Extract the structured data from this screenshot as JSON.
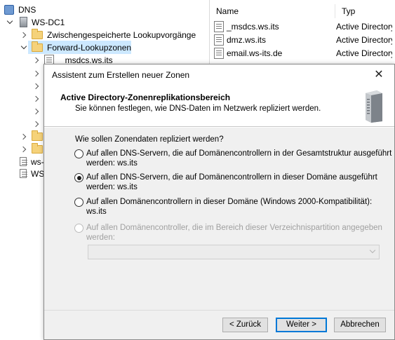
{
  "tree": {
    "root_label": "DNS",
    "server_label": "WS-DC1",
    "cache_label": "Zwischengespeicherte Lookupvorgänge",
    "forward_label": "Forward-Lookupzonen",
    "msdcs_label": "_msdcs.ws.its",
    "ws_label_1": "ws-",
    "ws_label_2": "WS"
  },
  "list": {
    "columns": [
      "Name",
      "Typ"
    ],
    "rows": [
      {
        "name": "_msdcs.ws.its",
        "type": "Active Directory"
      },
      {
        "name": "dmz.ws.its",
        "type": "Active Directory"
      },
      {
        "name": "email.ws-its.de",
        "type": "Active Directory"
      }
    ]
  },
  "dialog": {
    "title": "Assistent zum Erstellen neuer Zonen",
    "close_symbol": "✕",
    "header_title": "Active Directory-Zonenreplikationsbereich",
    "header_subtitle": "Sie können festlegen, wie DNS-Daten im Netzwerk repliziert werden.",
    "question": "Wie sollen Zonendaten repliziert werden?",
    "options": [
      {
        "line1": "Auf allen DNS-Servern, die auf Domänencontrollern in der Gesamtstruktur ausgeführt",
        "line2": "werden: ws.its",
        "checked": false,
        "disabled": false
      },
      {
        "line1": "Auf allen DNS-Servern, die auf Domänencontrollern in dieser Domäne ausgeführt",
        "line2": "werden: ws.its",
        "checked": true,
        "disabled": false
      },
      {
        "line1": "Auf allen Domänencontrollern in dieser Domäne (Windows 2000-Kompatibilität): ws.its",
        "line2": "",
        "checked": false,
        "disabled": false
      },
      {
        "line1": "Auf allen Domänencontroller, die im Bereich dieser Verzeichnispartition angegeben",
        "line2": "werden:",
        "checked": false,
        "disabled": true
      }
    ],
    "partition_value": "",
    "buttons": {
      "back": "< Zurück",
      "next": "Weiter >",
      "cancel": "Abbrechen"
    }
  },
  "colors": {
    "selection": "#cce8ff",
    "folder": "#f5d27a",
    "accent": "#0078d7",
    "dialog_body": "#f0f0f0"
  }
}
